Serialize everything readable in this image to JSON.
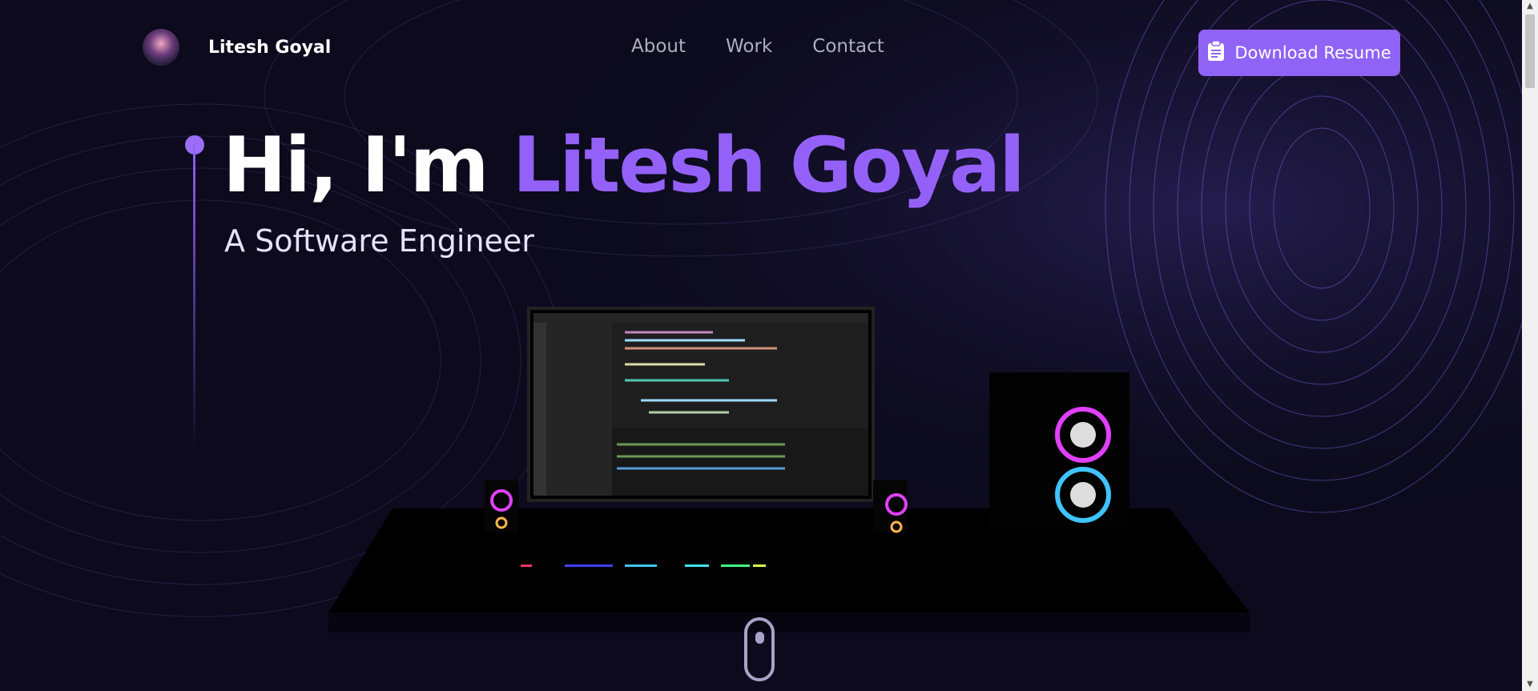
{
  "brand": {
    "name": "Litesh Goyal"
  },
  "nav": {
    "links": [
      "About",
      "Work",
      "Contact"
    ]
  },
  "resume_button": {
    "label": "Download Resume",
    "icon": "clipboard-icon"
  },
  "hero": {
    "greeting": "Hi, I'm",
    "name": "Litesh Goyal",
    "subtitle": "A Software Engineer"
  },
  "colors": {
    "accent": "#8f63f5",
    "background": "#0c0a1c",
    "name_accent": "#9461f8"
  }
}
